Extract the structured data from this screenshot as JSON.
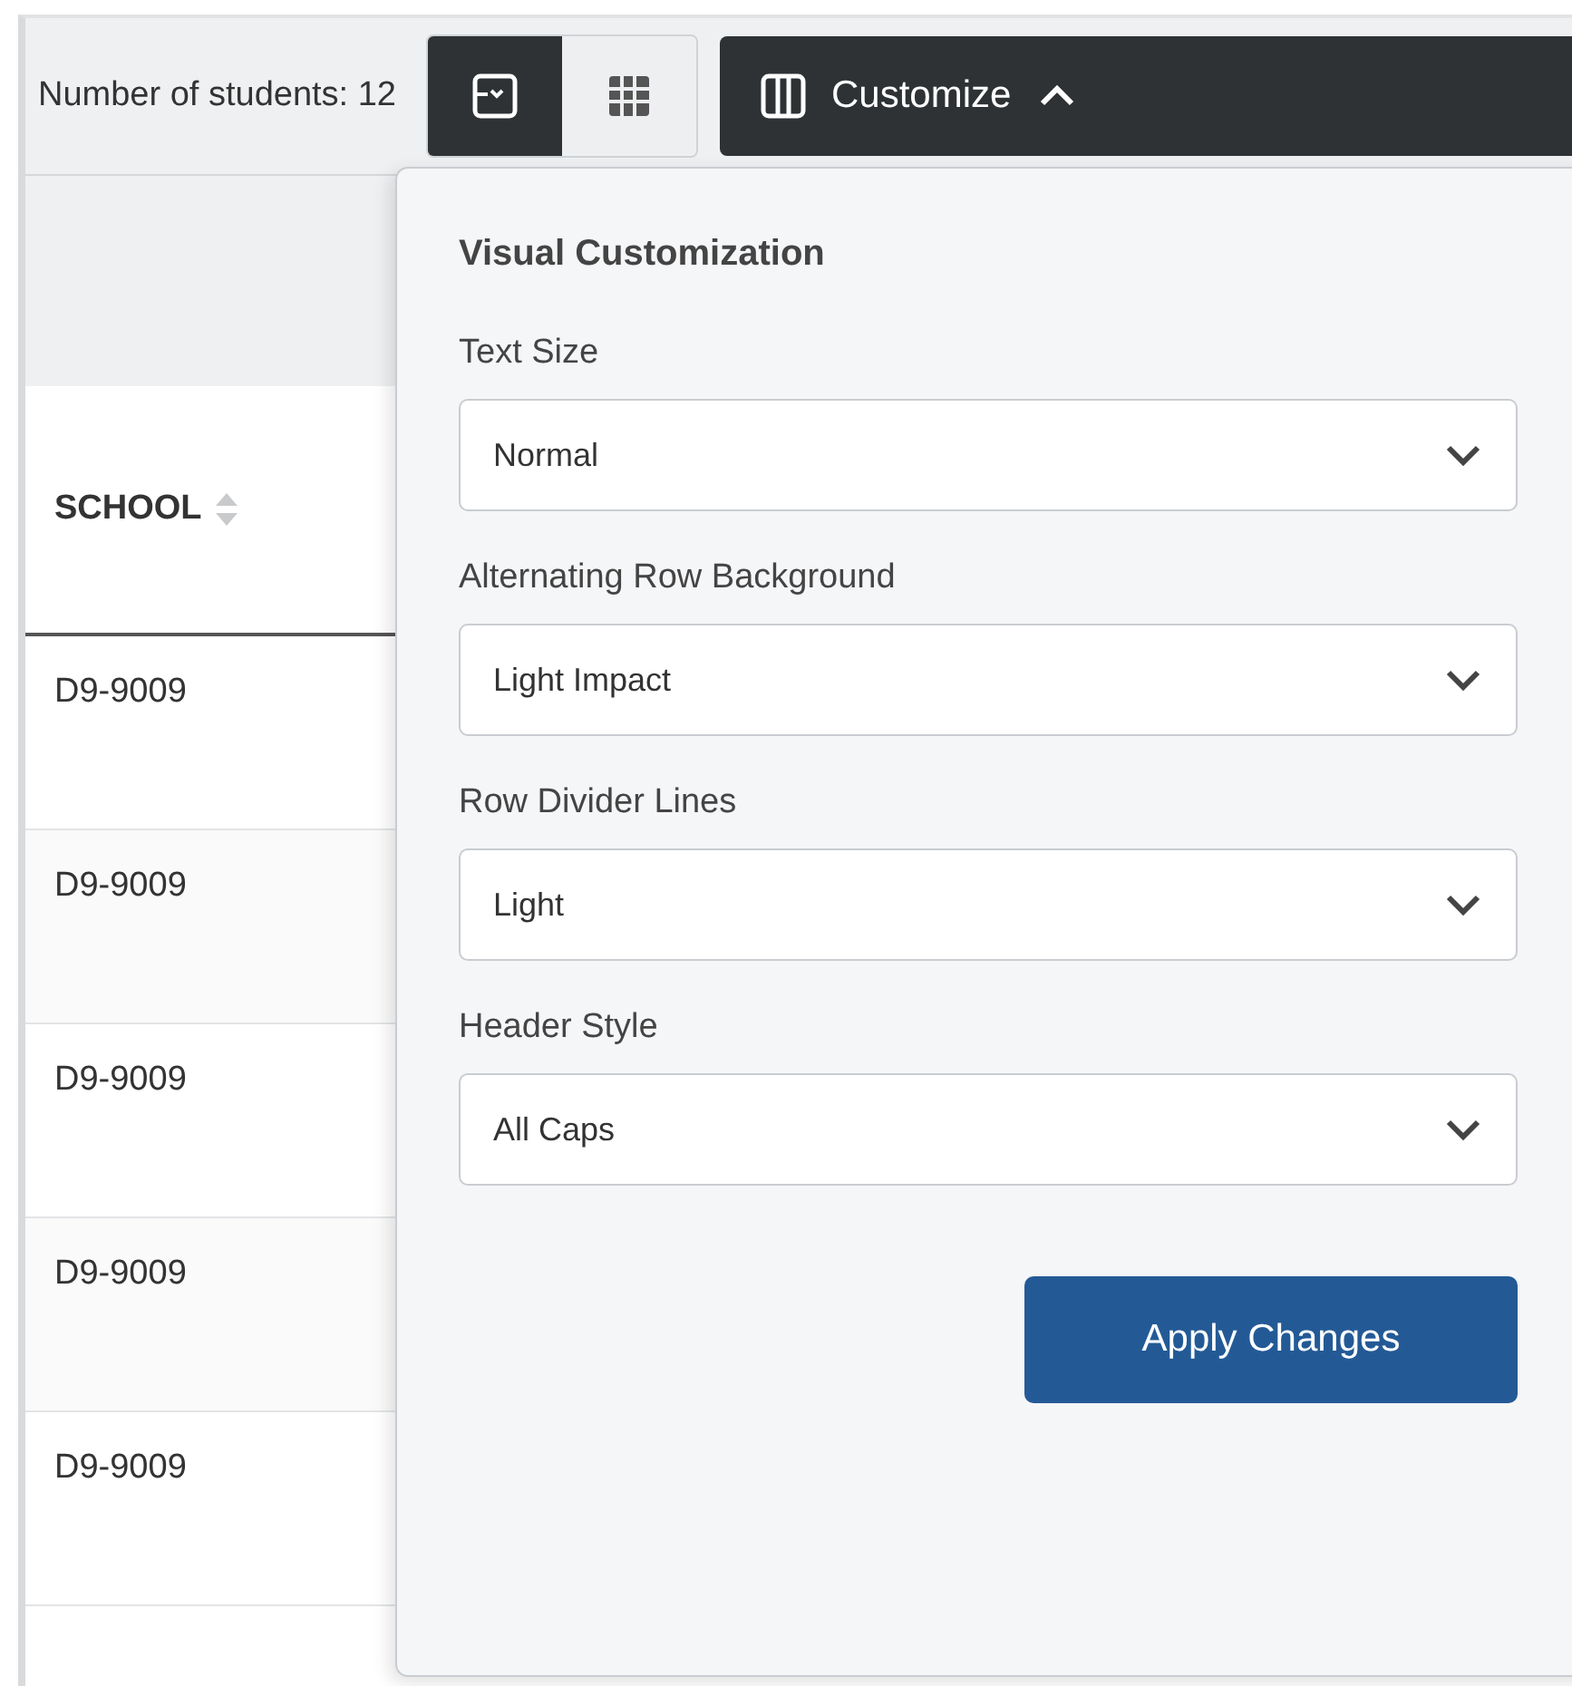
{
  "toolbar": {
    "count_label": "Number of students: 12",
    "view_toggles": [
      {
        "kind": "card",
        "selected": true
      },
      {
        "kind": "grid",
        "selected": false
      }
    ],
    "customize_button": {
      "label": "Customize",
      "expanded": true
    }
  },
  "table": {
    "columns": [
      {
        "label": "SCHOOL"
      }
    ],
    "rows": [
      {
        "school": "D9-9009"
      },
      {
        "school": "D9-9009"
      },
      {
        "school": "D9-9009"
      },
      {
        "school": "D9-9009"
      },
      {
        "school": "D9-9009"
      }
    ]
  },
  "panel": {
    "title": "Visual Customization",
    "fields": [
      {
        "label": "Text Size",
        "value": "Normal"
      },
      {
        "label": "Alternating Row Background",
        "value": "Light Impact"
      },
      {
        "label": "Row Divider Lines",
        "value": "Light"
      },
      {
        "label": "Header Style",
        "value": "All Caps"
      }
    ],
    "apply_button": "Apply Changes"
  }
}
